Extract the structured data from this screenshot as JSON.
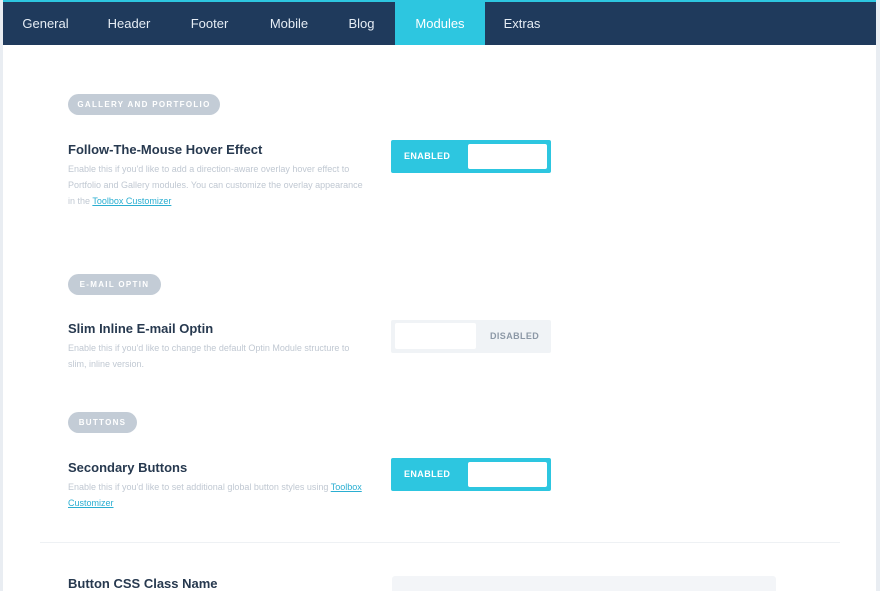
{
  "tabs": [
    {
      "label": "General",
      "active": false
    },
    {
      "label": "Header",
      "active": false
    },
    {
      "label": "Footer",
      "active": false
    },
    {
      "label": "Mobile",
      "active": false
    },
    {
      "label": "Blog",
      "active": false
    },
    {
      "label": "Modules",
      "active": true
    },
    {
      "label": "Extras",
      "active": false
    }
  ],
  "sections": {
    "gallery": {
      "pill": "GALLERY AND PORTFOLIO",
      "title": "Follow-The-Mouse Hover Effect",
      "desc_text": "Enable this if you'd like to add a direction-aware overlay hover effect to Portfolio and Gallery modules. You can customize the overlay appearance in the ",
      "desc_link": "Toolbox Customizer",
      "toggle_state": "ENABLED"
    },
    "optin": {
      "pill": "E-MAIL OPTIN",
      "title": "Slim Inline E-mail Optin",
      "desc_text": "Enable this if you'd like to change the default Optin Module structure to slim, inline version.",
      "toggle_state": "DISABLED"
    },
    "buttons": {
      "pill": "BUTTONS",
      "title": "Secondary Buttons",
      "desc_text": "Enable this if you'd like to set additional global button styles using ",
      "desc_link": "Toolbox Customizer",
      "toggle_state": "ENABLED"
    },
    "css_class": {
      "title": "Button CSS Class Name",
      "value": ""
    }
  },
  "colors": {
    "nav_bg": "#1f3a5c",
    "accent": "#2dc6e0",
    "pill_bg": "#c3ccd6",
    "title_text": "#27394f",
    "desc_text": "#c0c8d2",
    "link": "#2aaed1"
  }
}
